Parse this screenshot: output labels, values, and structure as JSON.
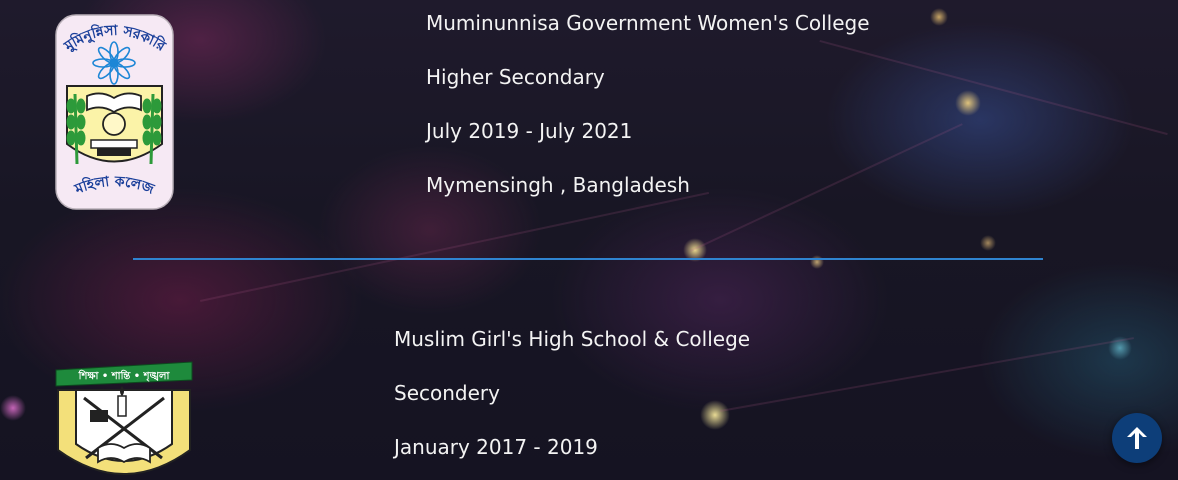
{
  "education": [
    {
      "logo_icon": "muminunnisa-college-logo",
      "institution": "Muminunnisa Government Women's College",
      "level": "Higher Secondary",
      "period": "July 2019 - July 2021",
      "location": "Mymensingh , Bangladesh",
      "logo_text_top": "মুমিনুন্নিসা সরকারি",
      "logo_text_bottom": "মহিলা কলেজ"
    },
    {
      "logo_icon": "muslim-girls-school-logo",
      "institution": "Muslim Girl's High School & College",
      "level": "Secondery",
      "period": "January 2017 - 2019",
      "logo_text_ribbon": "শিক্ষা • শান্তি • শৃঙ্খলা"
    }
  ],
  "scroll_top": {
    "icon": "arrow-up-icon"
  },
  "colors": {
    "divider": "#2f84d0",
    "scroll_button": "#0d3e79",
    "text": "#f3f3f3"
  }
}
